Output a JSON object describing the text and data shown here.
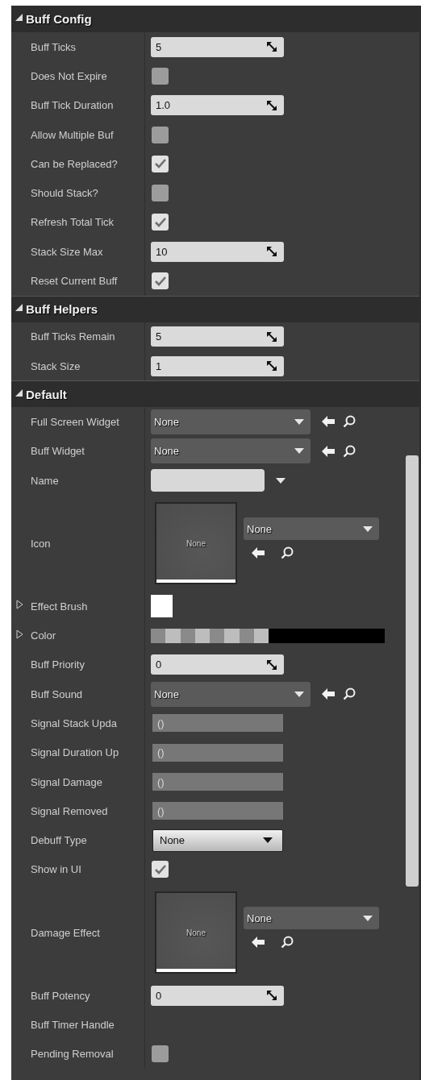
{
  "sections": [
    {
      "title": "Buff Config",
      "expanded": true,
      "rows": [
        {
          "kind": "number",
          "label": "Buff Ticks",
          "value": "5"
        },
        {
          "kind": "checkbox",
          "label": "Does Not Expire",
          "checked": false
        },
        {
          "kind": "number",
          "label": "Buff Tick Duration",
          "value": "1.0"
        },
        {
          "kind": "checkbox",
          "label": "Allow Multiple Buf",
          "checked": false
        },
        {
          "kind": "checkbox",
          "label": "Can be Replaced?",
          "checked": true
        },
        {
          "kind": "checkbox",
          "label": "Should Stack?",
          "checked": false
        },
        {
          "kind": "checkbox",
          "label": "Refresh Total Tick",
          "checked": true
        },
        {
          "kind": "number",
          "label": "Stack Size Max",
          "value": "10"
        },
        {
          "kind": "checkbox",
          "label": "Reset Current Buff",
          "checked": true
        }
      ]
    },
    {
      "title": "Buff Helpers",
      "expanded": true,
      "rows": [
        {
          "kind": "number",
          "label": "Buff Ticks Remain",
          "value": "5"
        },
        {
          "kind": "number",
          "label": "Stack Size",
          "value": "1"
        }
      ]
    },
    {
      "title": "Default",
      "expanded": true,
      "rows": [
        {
          "kind": "asset",
          "label": "Full Screen Widget",
          "value": "None"
        },
        {
          "kind": "asset",
          "label": "Buff Widget",
          "value": "None"
        },
        {
          "kind": "combo",
          "label": "Name"
        },
        {
          "kind": "thumbnail",
          "label": "Icon",
          "thumb_text": "None",
          "value": "None"
        },
        {
          "kind": "brush",
          "label": "Effect Brush",
          "expanded": false
        },
        {
          "kind": "color",
          "label": "Color",
          "expanded": false
        },
        {
          "kind": "number",
          "label": "Buff Priority",
          "value": "0"
        },
        {
          "kind": "asset",
          "label": "Buff Sound",
          "value": "None"
        },
        {
          "kind": "delegate",
          "label": "Signal Stack Upda",
          "value": "()"
        },
        {
          "kind": "delegate",
          "label": "Signal Duration Up",
          "value": "()"
        },
        {
          "kind": "delegate",
          "label": "Signal Damage",
          "value": "()"
        },
        {
          "kind": "delegate",
          "label": "Signal Removed",
          "value": "()"
        },
        {
          "kind": "enum",
          "label": "Debuff Type",
          "value": "None"
        },
        {
          "kind": "checkbox",
          "label": "Show in UI",
          "checked": true
        },
        {
          "kind": "thumbnail",
          "label": "Damage Effect",
          "thumb_text": "None",
          "value": "None"
        },
        {
          "kind": "number",
          "label": "Buff Potency",
          "value": "0"
        },
        {
          "kind": "empty",
          "label": "Buff Timer Handle"
        },
        {
          "kind": "checkbox",
          "label": "Pending Removal",
          "checked": false
        }
      ]
    }
  ]
}
